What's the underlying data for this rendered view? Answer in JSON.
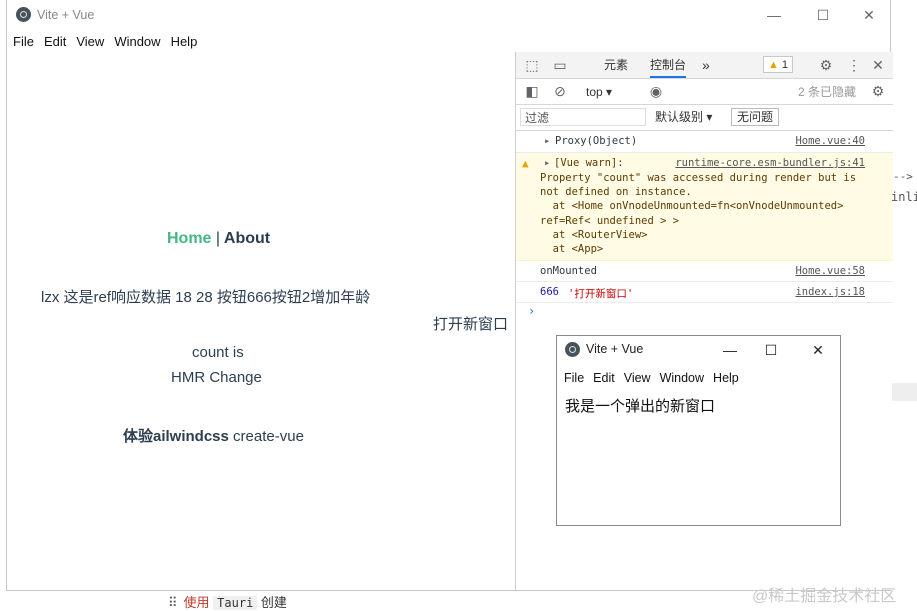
{
  "main_window": {
    "title": "Vite + Vue",
    "controls": {
      "minimize": "—",
      "maximize": "☐",
      "close": "✕"
    },
    "menu": [
      "File",
      "Edit",
      "View",
      "Window",
      "Help"
    ]
  },
  "app": {
    "nav": {
      "home": "Home",
      "separator": "|",
      "about": "About"
    },
    "ref_line": "lzx 这是ref响应数据 18 28 按钮666按钮2增加年龄",
    "open_window_link": "打开新窗口",
    "count_line": "count is",
    "hmr_line": "HMR Change",
    "tailwind_bold": "体验ailwindcss",
    "tailwind_rest": " create-vue"
  },
  "devtools": {
    "tabs": {
      "elements": "元素",
      "console": "控制台",
      "more": "»"
    },
    "warning_count": "1",
    "context": "top",
    "hidden_count": "2 条已隐藏",
    "filter_placeholder": "过滤",
    "level": "默认级别",
    "no_issues": "无问题",
    "messages": [
      {
        "text": "Proxy(Object)",
        "source": "Home.vue:40"
      },
      {
        "header": "[Vue warn]:",
        "source": "runtime-core.esm-bundler.js:41",
        "lines": [
          "Property \"count\" was accessed during render but is",
          "not defined on instance.",
          "  at <Home onVnodeUnmounted=fn<onVnodeUnmounted>",
          "ref=Ref< undefined > >",
          "  at <RouterView>",
          "  at <App>"
        ]
      },
      {
        "text": "onMounted",
        "source": "Home.vue:58"
      },
      {
        "num": "666",
        "str": "'打开新窗口'",
        "source": "index.js:18"
      }
    ]
  },
  "popup": {
    "title": "Vite + Vue",
    "menu": [
      "File",
      "Edit",
      "View",
      "Window",
      "Help"
    ],
    "body": "我是一个弹出的新窗口"
  },
  "background": {
    "arrow": "-->",
    "inli": "inli"
  },
  "footer": {
    "use": "使用",
    "code": "Tauri",
    "create": "创建"
  },
  "watermark": "@稀土掘金技术社区"
}
